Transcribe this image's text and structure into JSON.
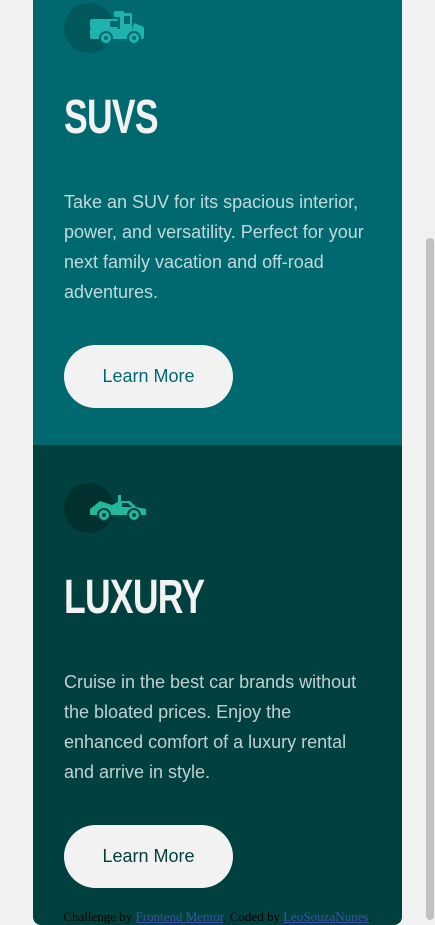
{
  "cards": [
    {
      "icon": "suv-car-icon",
      "title": "SUVs",
      "description": "Take an SUV for its spacious interior, power, and versatility. Perfect for your next family vacation and off-road adventures.",
      "button_label": "Learn More",
      "background_color": "#006970"
    },
    {
      "icon": "luxury-car-icon",
      "title": "Luxury",
      "description": "Cruise in the best car brands without the bloated prices. Enjoy the enhanced comfort of a luxury rental and arrive in style.",
      "button_label": "Learn More",
      "background_color": "#004140"
    }
  ],
  "attribution": {
    "prefix": "Challenge by ",
    "link1_text": "Frontend Mentor",
    "middle": ". Coded by ",
    "link2_text": "LeoSouzaNunes",
    "suffix": "."
  }
}
